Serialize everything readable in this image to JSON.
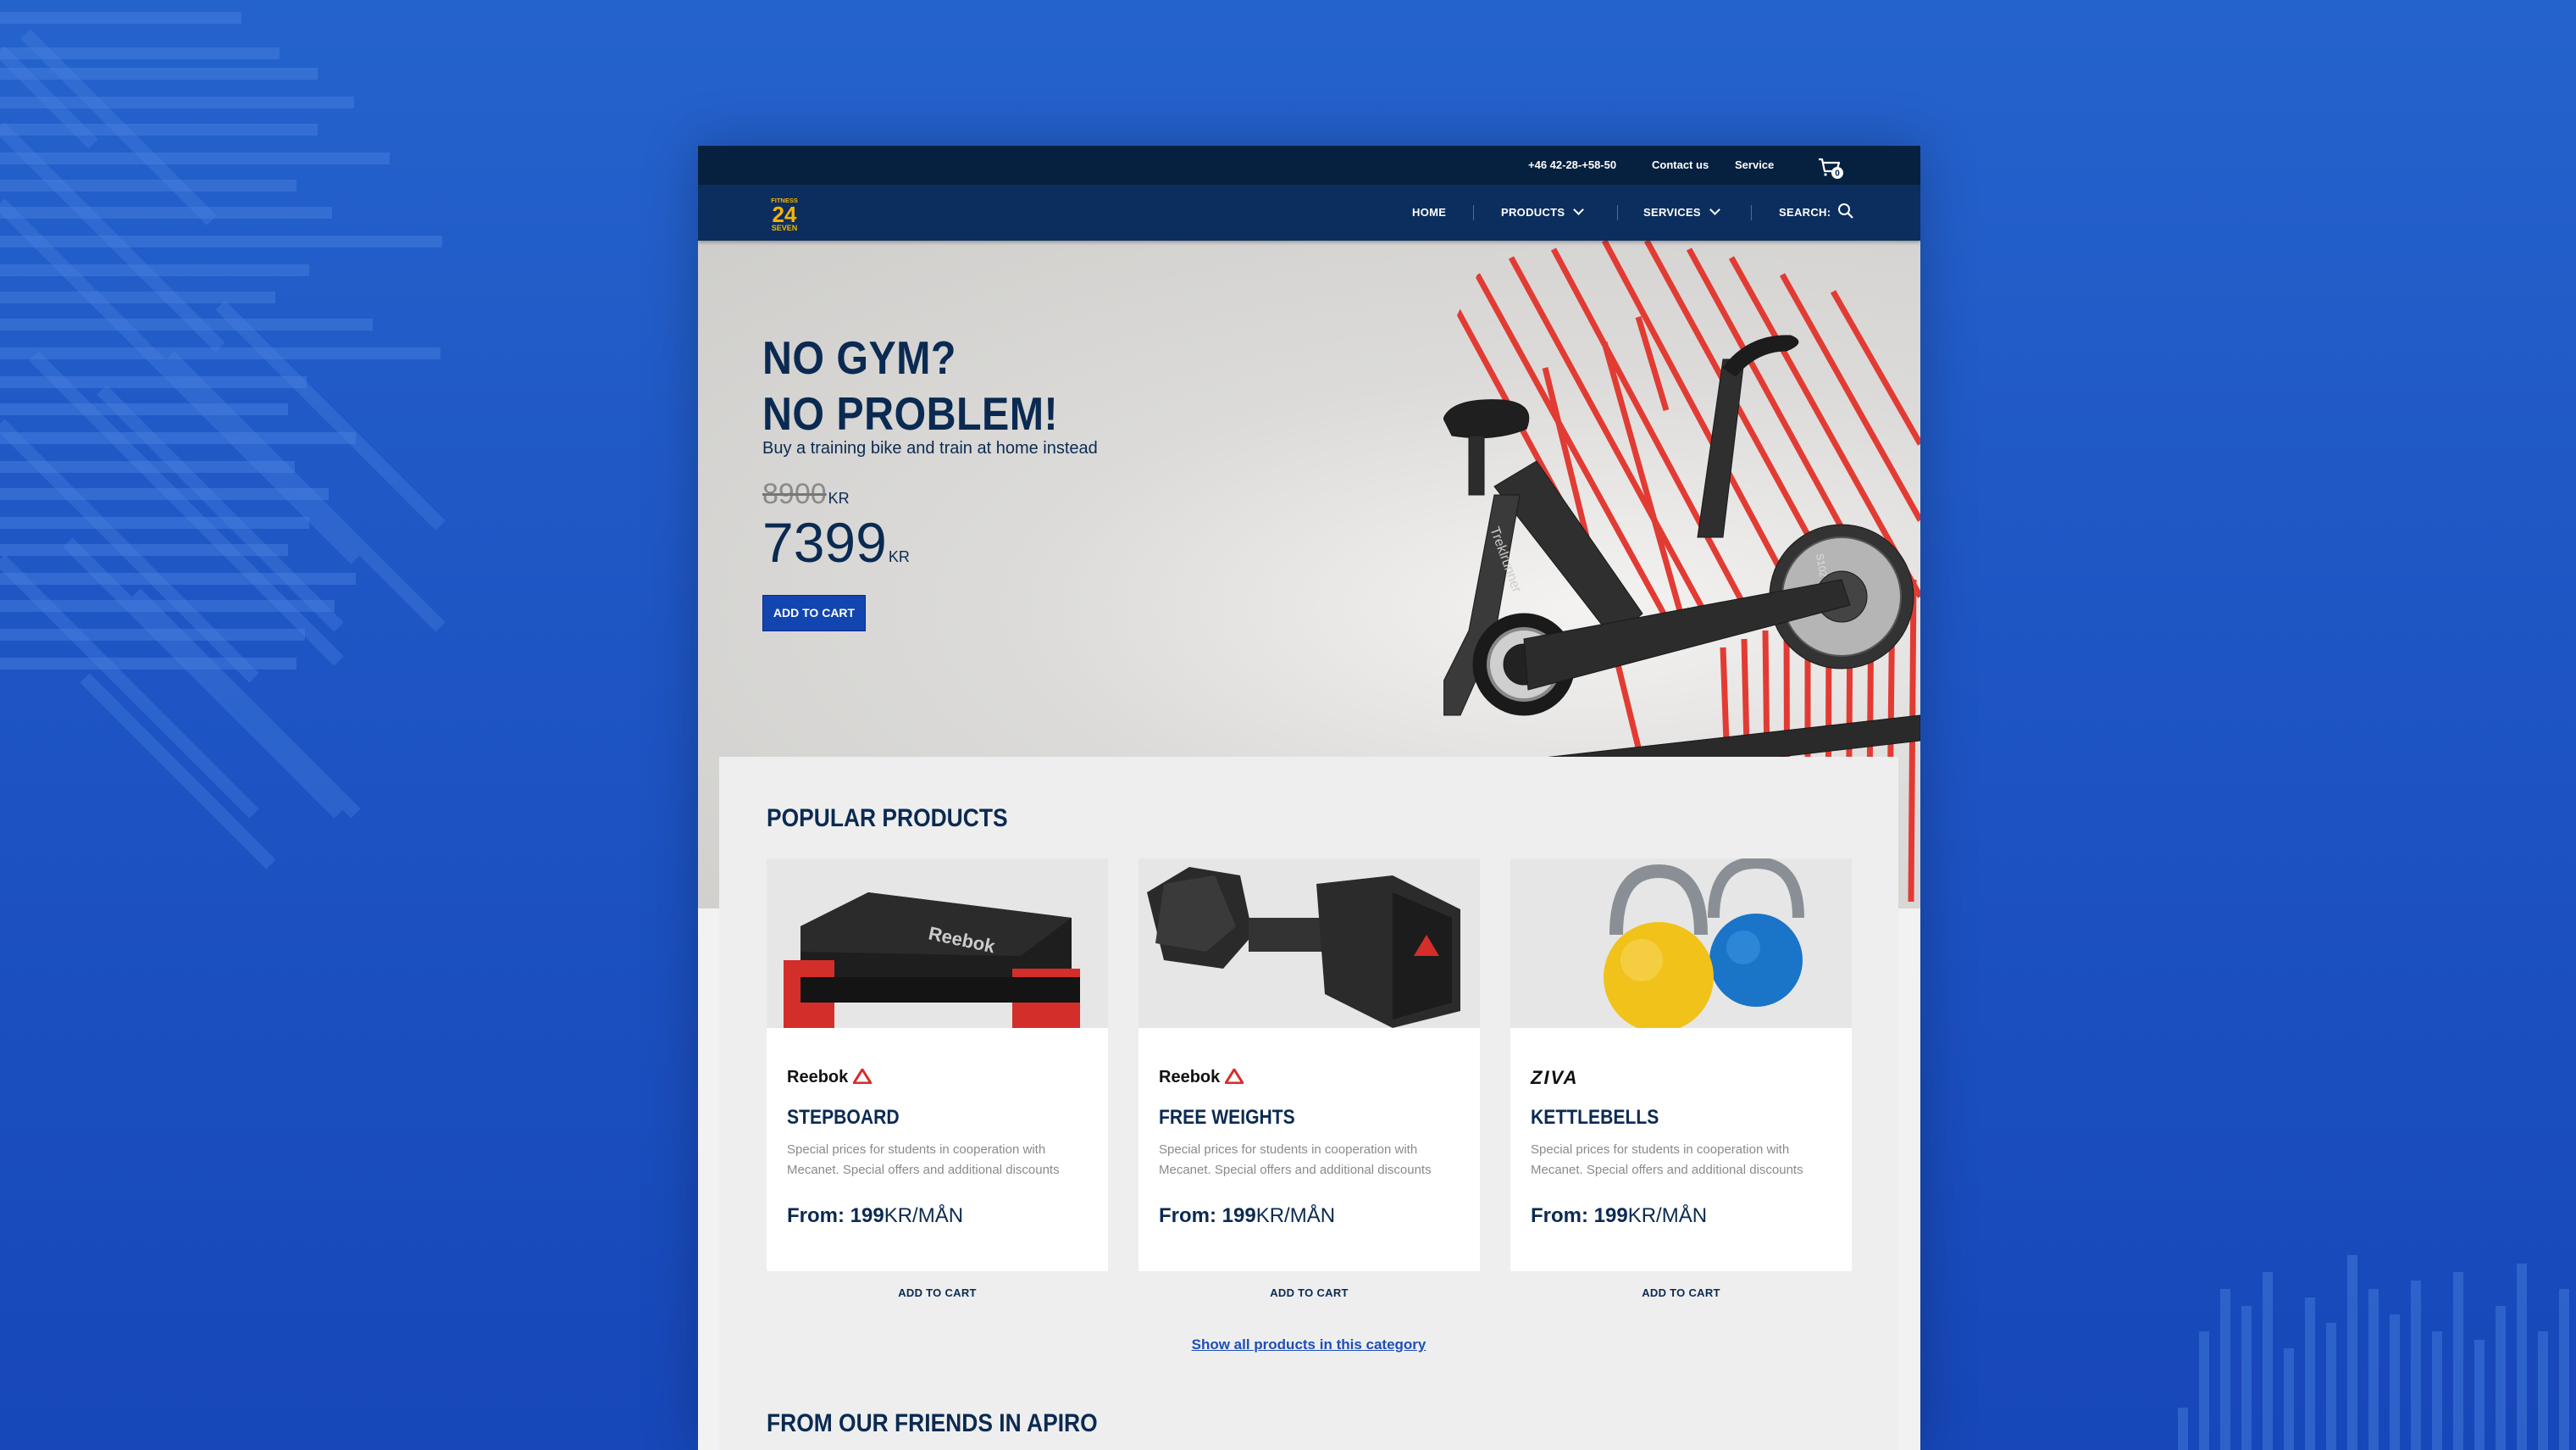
{
  "topbar": {
    "phone": "+46 42-28-+58-50",
    "contact": "Contact us",
    "service": "Service",
    "cart_count": "0"
  },
  "brand": {
    "logo_line1": "FITNESS",
    "logo_line2": "24",
    "logo_line3": "SEVEN"
  },
  "nav": {
    "home": "HOME",
    "products": "PRODUCTS",
    "services": "SERVICES",
    "search": "SEARCH:"
  },
  "hero": {
    "title_line1": "NO GYM?",
    "title_line2": "NO PROBLEM!",
    "subtitle": "Buy a training bike and train at home instead",
    "old_price": "8900",
    "old_currency": "KR",
    "new_price": "7399",
    "new_currency": "KR",
    "cta": "ADD TO CART",
    "bike_brand": "Treklrunner",
    "bike_model": "S102"
  },
  "popular": {
    "title": "POPULAR PRODUCTS",
    "products": [
      {
        "brand": "Reebok",
        "name": "STEPBOARD",
        "description": "Special prices for students in cooperation with Mecanet. Special offers and additional discounts",
        "price_prefix": "From: 199",
        "price_suffix": "KR/MÅN",
        "cart": "ADD TO CART"
      },
      {
        "brand": "Reebok",
        "name": "FREE WEIGHTS",
        "description": "Special prices for students in cooperation with Mecanet. Special offers and additional discounts",
        "price_prefix": "From: 199",
        "price_suffix": "KR/MÅN",
        "cart": "ADD TO CART"
      },
      {
        "brand": "ZIVA",
        "name": "KETTLEBELLS",
        "description": "Special prices for students in cooperation with Mecanet. Special offers and additional discounts",
        "price_prefix": "From: 199",
        "price_suffix": "KR/MÅN",
        "cart": "ADD TO CART"
      }
    ],
    "show_all": "Show all products in this category"
  },
  "friends": {
    "title": "FROM OUR FRIENDS IN APIRO"
  },
  "colors": {
    "navy": "#0b2a52",
    "topbar": "#06203f",
    "navbar": "#0c2e5e",
    "accent_blue": "#1245b0",
    "accent_red": "#e23b33",
    "logo_yellow": "#f5b400"
  }
}
